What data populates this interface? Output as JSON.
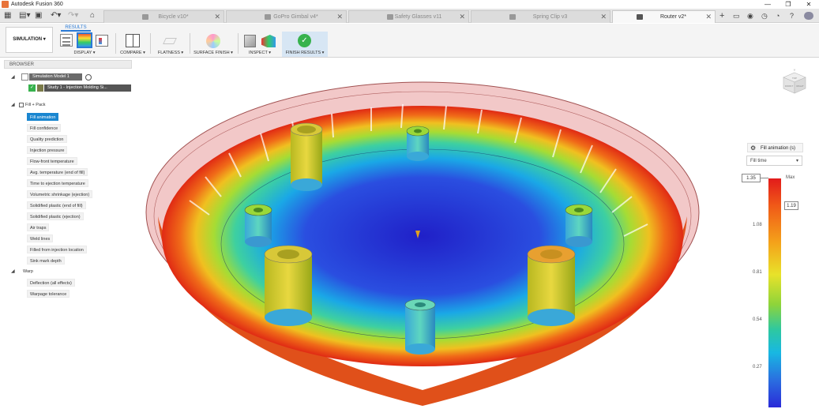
{
  "window": {
    "title": "Autodesk Fusion 360"
  },
  "tabs": [
    {
      "label": "Bicycle v10*",
      "active": false
    },
    {
      "label": "GoPro Gimbal v4*",
      "active": false
    },
    {
      "label": "Safety Glasses v11",
      "active": false
    },
    {
      "label": "Spring Clip v3",
      "active": false
    },
    {
      "label": "Router v2*",
      "active": true
    }
  ],
  "ribbon": {
    "workspace": "SIMULATION",
    "active_tab": "RESULTS",
    "groups": [
      "DISPLAY",
      "COMPARE",
      "FLATNESS",
      "SURFACE FINISH",
      "INSPECT",
      "FINISH RESULTS"
    ],
    "chevron": "▾"
  },
  "browser": {
    "header": "BROWSER",
    "model": "Simulation Model 1",
    "study": "Study 1 - Injection Molding Si...",
    "sections": [
      {
        "label": "Fill + Pack",
        "items": [
          "Fill animation",
          "Fill confidence",
          "Quality prediction",
          "Injection pressure",
          "Flow-front temperature",
          "Avg. temperature (end of fill)",
          "Time to ejection temperature",
          "Volumetric shrinkage (ejection)",
          "Solidified plastic (end of fill)",
          "Solidified plastic (ejection)",
          "Air traps",
          "Weld lines",
          "Filled from injection location",
          "Sink mark depth"
        ]
      },
      {
        "label": "Warp",
        "items": [
          "Deflection (all effects)",
          "Warpage tolerance"
        ]
      }
    ],
    "selected_item": "Fill animation"
  },
  "legend": {
    "title": "Fill animation (s)",
    "dropdown": "Fill time",
    "current": "1.35",
    "max_label": "Max",
    "marker_value": "1.19",
    "ticks": [
      "1.08",
      "0.81",
      "0.54",
      "0.27"
    ],
    "colors": {
      "max": "#e21b1b",
      "min": "#2a2ad8"
    }
  },
  "viewcube": {
    "front": "FRONT",
    "right": "RIGHT",
    "top": "TOP",
    "axis": "Y"
  }
}
